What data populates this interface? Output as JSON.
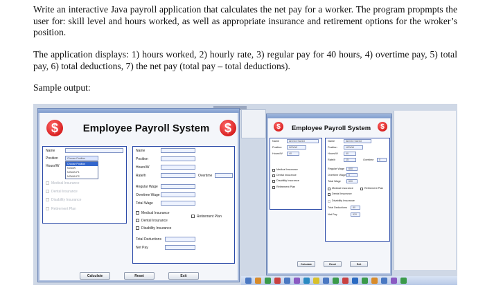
{
  "document": {
    "paragraph1": "Write an interactive Java payroll application that calculates the net pay for a worker. The program propmpts the user for: skill level and hours worked, as well as appropriate insurance and retirement options for the wroker’s position.",
    "paragraph2": "The application displays: 1) hours worked, 2) hourly rate, 3) regular pay for 40 hours, 4) overtime pay, 5) total pay, 6) total deductions, 7) the net pay (total pay – total deductions).",
    "paragraph3": "Sample output:"
  },
  "large_window": {
    "title": "Employee Payroll System",
    "dollar": "$",
    "left_panel": {
      "name_label": "Name",
      "position_label": "Position",
      "position_value": "Choose Position",
      "hours_label": "Hours/W",
      "dropdown_items": [
        "Choose Position",
        "NOWW",
        "NOWW-P1",
        "NOWW-P2"
      ],
      "medical": "Medical Insurance",
      "dental": "Dental Insurance",
      "disability": "Disability Insurance",
      "retirement": "Retirement Plan"
    },
    "right_panel": {
      "name_label": "Name",
      "position_label": "Position",
      "hours_label": "Hours/W",
      "rate_label": "Rate/h",
      "overtime_label": "Overtime",
      "regular_wage": "Regular Wage",
      "overtime_wage": "Overtime Wage",
      "total_wage": "Total Wage",
      "medical": "Medical Insurance",
      "dental": "Dental Insurance",
      "disability": "Disability Insurance",
      "retirement": "Retirement Plan",
      "total_deductions": "Total Deductions",
      "net_pay": "Net Pay"
    },
    "buttons": {
      "calculate": "Calculate",
      "reset": "Reset",
      "exit": "Exit"
    }
  },
  "small_window": {
    "title": "Employee Payroll System",
    "dollar": "$",
    "left_panel": {
      "name_label": "Name",
      "name_value": "Ahmed Saeed",
      "position_label": "Position",
      "position_value": "NOWW",
      "hours_label": "Hours/W",
      "hours_value": "40",
      "medical": "Medical Insurance",
      "dental": "Dental Insurance",
      "disability": "Disability Insurance",
      "retirement": "Retirement Plan"
    },
    "right_panel": {
      "name_label": "Name",
      "name_value": "Ahmed Saeed",
      "position_label": "Position",
      "position_value": "NOWW",
      "hours_label": "Hours/W",
      "hours_value": "40",
      "rate_label": "Rate/h",
      "rate_value": "15",
      "overtime_label": "Overtime",
      "overtime_value": "0",
      "regular_wage": "Regular Wage",
      "regular_value": "600",
      "overtime_wage": "Overtime Wage",
      "overtime_wage_value": "0",
      "total_wage": "Total Wage",
      "total_wage_value": "600",
      "medical": "Medical Insurance",
      "retirement": "Retirement Plan",
      "dental": "Dental Insurance",
      "disability": "Disability Insurance",
      "total_deductions": "Total Deductions",
      "total_deductions_value": "80",
      "net_pay": "Net Pay",
      "net_pay_value": "520"
    },
    "buttons": {
      "calculate": "Calculate",
      "reset": "Reset",
      "exit": "Exit"
    }
  },
  "colors": {
    "accent": "#2b4aa8",
    "dollar_red": "#d00000",
    "window_bg": "#f4f6fa",
    "desktop": "#cfd8e6"
  }
}
